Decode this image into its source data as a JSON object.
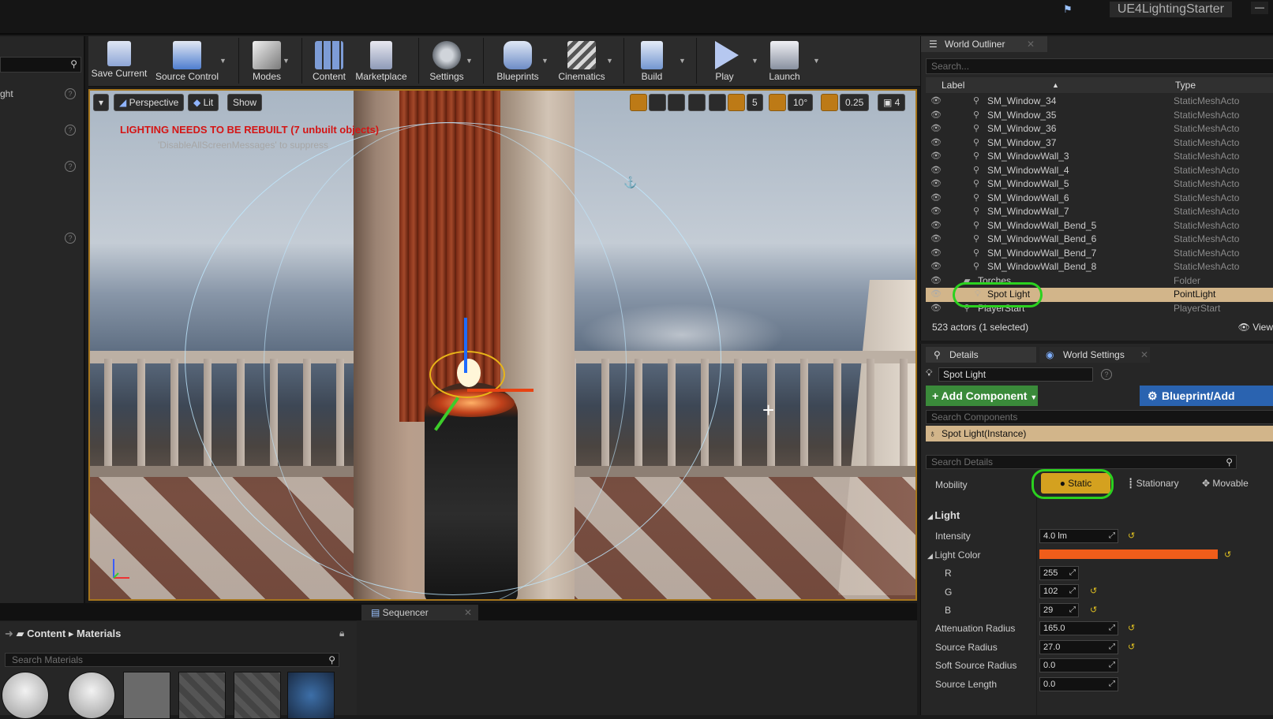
{
  "titlebar": {
    "app_title": "UE4LightingStarter"
  },
  "left_panel": {
    "label": "ght"
  },
  "toolbar": {
    "buttons": [
      {
        "label": "Save Current",
        "color": "#8ea6d6"
      },
      {
        "label": "Source Control",
        "color": "#4f7ed0"
      },
      {
        "label": "Modes",
        "color": "#cfcfcf"
      },
      {
        "label": "Content",
        "color": "#7d9cd6"
      },
      {
        "label": "Marketplace",
        "color": "#c9c9d6"
      },
      {
        "label": "Settings",
        "color": "#9aa0a8"
      },
      {
        "label": "Blueprints",
        "color": "#9ab0d8"
      },
      {
        "label": "Cinematics",
        "color": "#c0c0c0"
      },
      {
        "label": "Build",
        "color": "#9fb7e0"
      },
      {
        "label": "Play",
        "color": "#b6c8f0"
      },
      {
        "label": "Launch",
        "color": "#c0c8d6"
      }
    ]
  },
  "viewport": {
    "perspective": "Perspective",
    "lit": "Lit",
    "show": "Show",
    "grid_snap": "5",
    "angle_snap": "10°",
    "scale_snap": "0.25",
    "camera_speed": "4",
    "warning_line1": "LIGHTING NEEDS TO BE REBUILT (7 unbuilt objects)",
    "warning_line2": "'DisableAllScreenMessages' to suppress"
  },
  "content_browser": {
    "path_root": "Content",
    "path_folder": "Materials",
    "search_placeholder": "Search Materials"
  },
  "sequencer": {
    "tab": "Sequencer"
  },
  "outliner": {
    "tab": "World Outliner",
    "search_placeholder": "Search...",
    "col_label": "Label",
    "col_type": "Type",
    "rows": [
      {
        "name": "SM_Window_34",
        "type": "StaticMeshActo"
      },
      {
        "name": "SM_Window_35",
        "type": "StaticMeshActo"
      },
      {
        "name": "SM_Window_36",
        "type": "StaticMeshActo"
      },
      {
        "name": "SM_Window_37",
        "type": "StaticMeshActo"
      },
      {
        "name": "SM_WindowWall_3",
        "type": "StaticMeshActo"
      },
      {
        "name": "SM_WindowWall_4",
        "type": "StaticMeshActo"
      },
      {
        "name": "SM_WindowWall_5",
        "type": "StaticMeshActo"
      },
      {
        "name": "SM_WindowWall_6",
        "type": "StaticMeshActo"
      },
      {
        "name": "SM_WindowWall_7",
        "type": "StaticMeshActo"
      },
      {
        "name": "SM_WindowWall_Bend_5",
        "type": "StaticMeshActo"
      },
      {
        "name": "SM_WindowWall_Bend_6",
        "type": "StaticMeshActo"
      },
      {
        "name": "SM_WindowWall_Bend_7",
        "type": "StaticMeshActo"
      },
      {
        "name": "SM_WindowWall_Bend_8",
        "type": "StaticMeshActo"
      },
      {
        "name": "Torches",
        "type": "Folder"
      },
      {
        "name": "Spot Light",
        "type": "PointLight"
      },
      {
        "name": "PlayerStart",
        "type": "PlayerStart"
      }
    ],
    "count": "523 actors (1 selected)",
    "view": "View"
  },
  "details": {
    "tab_details": "Details",
    "tab_world_settings": "World Settings",
    "actor_name": "Spot Light",
    "add_component": "+ Add Component",
    "blueprint_add": "Blueprint/Add",
    "search_components": "Search Components",
    "component_row": "Spot Light(Instance)",
    "search_details": "Search Details",
    "mobility_label": "Mobility",
    "mobility_static": "Static",
    "mobility_stationary": "Stationary",
    "mobility_movable": "Movable",
    "section_light": "Light",
    "props": [
      {
        "label": "Intensity",
        "value": "4.0 lm"
      },
      {
        "label": "Light Color",
        "value": ""
      },
      {
        "label": "R",
        "value": "255"
      },
      {
        "label": "G",
        "value": "102"
      },
      {
        "label": "B",
        "value": "29"
      },
      {
        "label": "Attenuation Radius",
        "value": "165.0"
      },
      {
        "label": "Source Radius",
        "value": "27.0"
      },
      {
        "label": "Soft Source Radius",
        "value": "0.0"
      },
      {
        "label": "Source Length",
        "value": "0.0"
      }
    ],
    "light_color_hex": "#f05d1a"
  }
}
